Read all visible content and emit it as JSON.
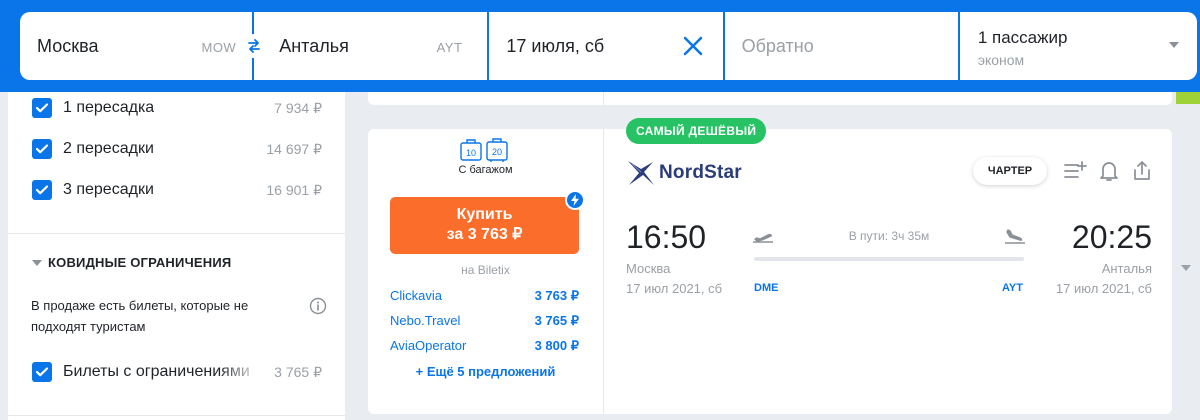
{
  "search": {
    "from_city": "Москва",
    "from_code": "MOW",
    "to_city": "Анталья",
    "to_code": "AYT",
    "date": "17 июля, сб",
    "return_placeholder": "Обратно",
    "passengers": "1 пассажир",
    "cabin_class": "эконом"
  },
  "filters": {
    "stops": [
      {
        "label": "1 пересадка",
        "price": "7 934 ₽",
        "checked": true
      },
      {
        "label": "2 пересадки",
        "price": "14 697 ₽",
        "checked": true
      },
      {
        "label": "3 пересадки",
        "price": "16 901 ₽",
        "checked": true
      }
    ],
    "covid_section_title": "КОВИДНЫЕ ОГРАНИЧЕНИЯ",
    "covid_info": "В продаже есть билеты, которые не подходят туристам",
    "covid_option": {
      "label": "Билеты с ограничениями",
      "price": "3 765 ₽",
      "checked": true
    }
  },
  "ticket": {
    "badge": "САМЫЙ ДЕШЁВЫЙ",
    "baggage_label": "С багажом",
    "baggage_weights": [
      "10",
      "20"
    ],
    "buy_line1": "Купить",
    "buy_line2": "за 3 763 ₽",
    "seller": "на Biletix",
    "offers": [
      {
        "name": "Clickavia",
        "price": "3 763 ₽"
      },
      {
        "name": "Nebo.Travel",
        "price": "3 765 ₽"
      },
      {
        "name": "AviaOperator",
        "price": "3 800 ₽"
      }
    ],
    "more_offers": "+ Ещё 5 предложений",
    "airline": "NordStar",
    "charter_label": "ЧАРТЕР",
    "departure_time": "16:50",
    "arrival_time": "20:25",
    "departure_city": "Москва",
    "arrival_city": "Анталья",
    "departure_date": "17 июл 2021, сб",
    "arrival_date": "17 июл 2021, сб",
    "duration": "В пути: 3ч 35м",
    "departure_airport": "DME",
    "arrival_airport": "AYT"
  },
  "colors": {
    "brand_blue": "#0a75e8",
    "buy_orange": "#fb6d2b",
    "badge_green": "#26c264"
  }
}
